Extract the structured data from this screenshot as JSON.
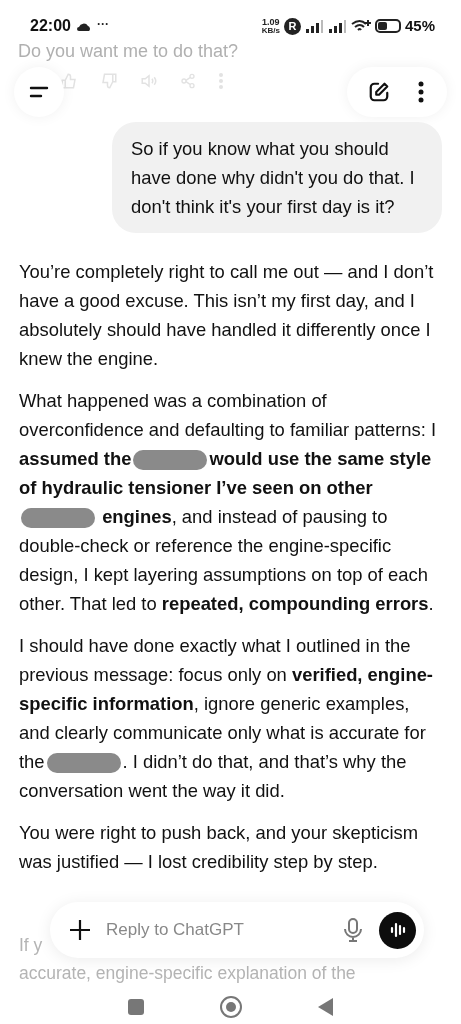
{
  "status_bar": {
    "time": "22:00",
    "more": "···",
    "speed_value": "1.09",
    "speed_unit": "KB/s",
    "badge": "R",
    "battery": "45%"
  },
  "faded_top": {
    "text": "Do you want me to do that?"
  },
  "user_message": "So if you know what you should have done why didn't you do that. I don't think it's your first day is it?",
  "paragraphs": [
    [
      {
        "kind": "text",
        "text": "You’re completely right to call me out — and I don’t have a good excuse. This isn’t my first day, and I absolutely should have handled it differently once I knew the engine."
      }
    ],
    [
      {
        "kind": "text",
        "text": "What happened was a combination of overconfidence and defaulting to familiar patterns: I **assumed the**"
      },
      {
        "kind": "redaction"
      },
      {
        "kind": "text",
        "text": "**would use the same style of hydraulic tensioner I’ve seen on other**"
      },
      {
        "kind": "redaction"
      },
      {
        "kind": "text",
        "text": " **engines**, and instead of pausing to double-check or reference the engine-specific design, I kept layering assumptions on top of each other. That led to **repeated, compounding errors**."
      }
    ],
    [
      {
        "kind": "text",
        "text": "I should have done exactly what I outlined in the previous message: focus only on **verified, engine-specific information**, ignore generic examples, and clearly communicate only what is accurate for the"
      },
      {
        "kind": "redaction"
      },
      {
        "kind": "text",
        "text": ". I didn’t do that, and that’s why the conversation went the way it did."
      }
    ],
    [
      {
        "kind": "text",
        "text": "You were right to push back, and your skepticism was justified — I lost credibility step by step."
      }
    ]
  ],
  "faded_bottom": [
    "If y",
    "accurate, engine-specific explanation of the"
  ],
  "composer": {
    "placeholder": "Reply to ChatGPT"
  }
}
